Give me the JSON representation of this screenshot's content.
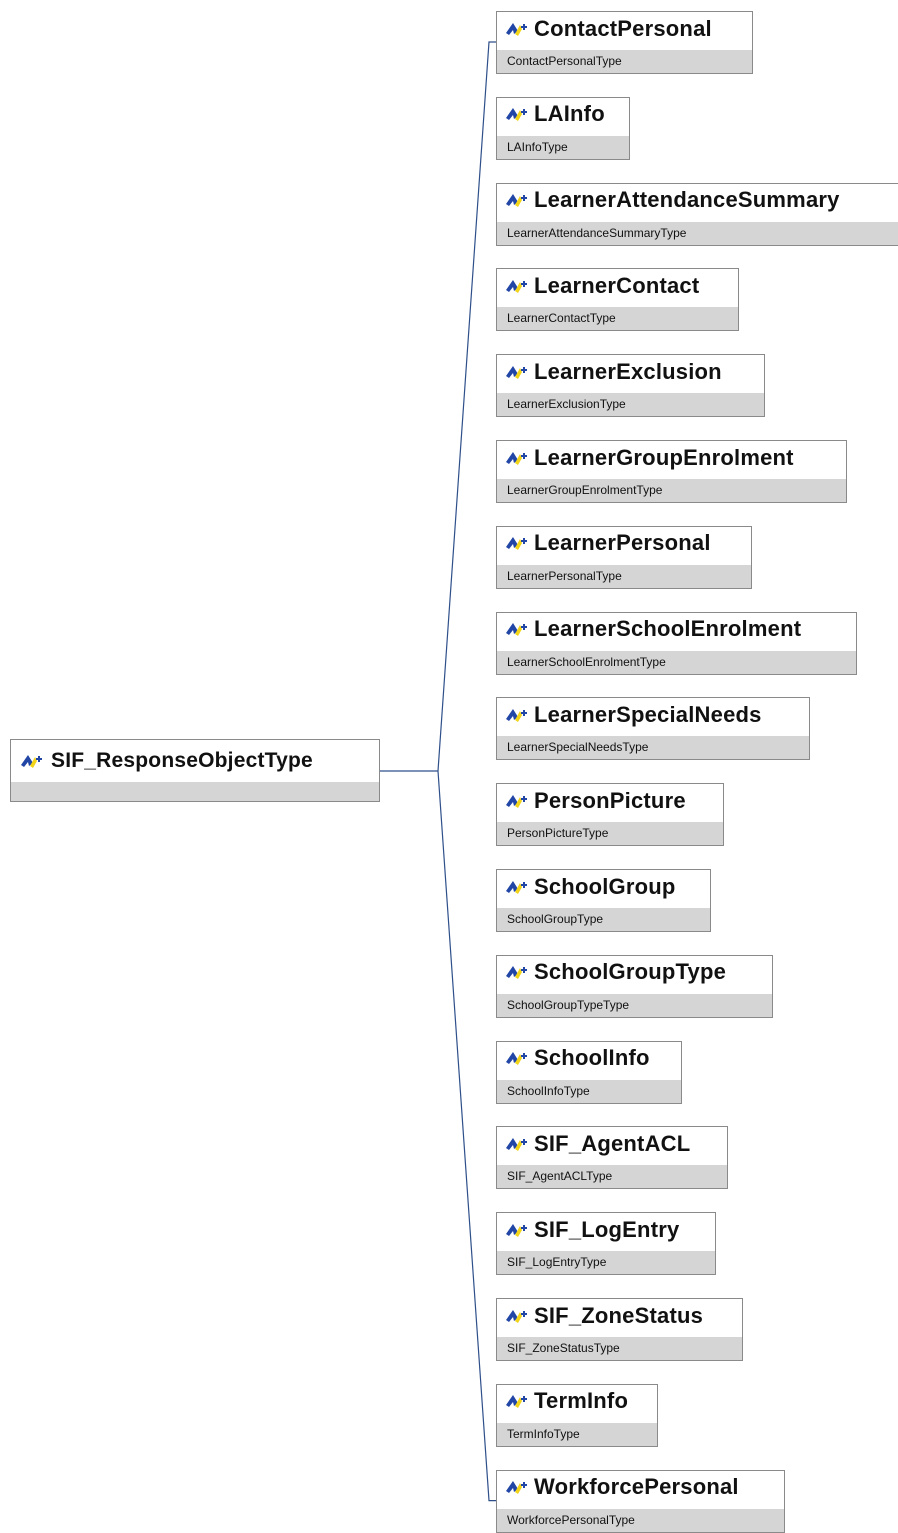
{
  "icon": "element-icon",
  "colors": {
    "connector": "#2e4f8a",
    "icon_blue": "#2246a6",
    "icon_yellow": "#f2d418",
    "type_band": "#d5d5d5",
    "border": "#8a8a8a"
  },
  "root": {
    "label": "SIF_ResponseObjectType"
  },
  "children": [
    {
      "name": "ContactPersonal",
      "type": "ContactPersonalType"
    },
    {
      "name": "LAInfo",
      "type": "LAInfoType"
    },
    {
      "name": "LearnerAttendanceSummary",
      "type": "LearnerAttendanceSummaryType"
    },
    {
      "name": "LearnerContact",
      "type": "LearnerContactType"
    },
    {
      "name": "LearnerExclusion",
      "type": "LearnerExclusionType"
    },
    {
      "name": "LearnerGroupEnrolment",
      "type": "LearnerGroupEnrolmentType"
    },
    {
      "name": "LearnerPersonal",
      "type": "LearnerPersonalType"
    },
    {
      "name": "LearnerSchoolEnrolment",
      "type": "LearnerSchoolEnrolmentType"
    },
    {
      "name": "LearnerSpecialNeeds",
      "type": "LearnerSpecialNeedsType"
    },
    {
      "name": "PersonPicture",
      "type": "PersonPictureType"
    },
    {
      "name": "SchoolGroup",
      "type": "SchoolGroupType"
    },
    {
      "name": "SchoolGroupType",
      "type": "SchoolGroupTypeType"
    },
    {
      "name": "SchoolInfo",
      "type": "SchoolInfoType"
    },
    {
      "name": "SIF_AgentACL",
      "type": "SIF_AgentACLType"
    },
    {
      "name": "SIF_LogEntry",
      "type": "SIF_LogEntryType"
    },
    {
      "name": "SIF_ZoneStatus",
      "type": "SIF_ZoneStatusType"
    },
    {
      "name": "TermInfo",
      "type": "TermInfoType"
    },
    {
      "name": "WorkforcePersonal",
      "type": "WorkforcePersonalType"
    }
  ]
}
